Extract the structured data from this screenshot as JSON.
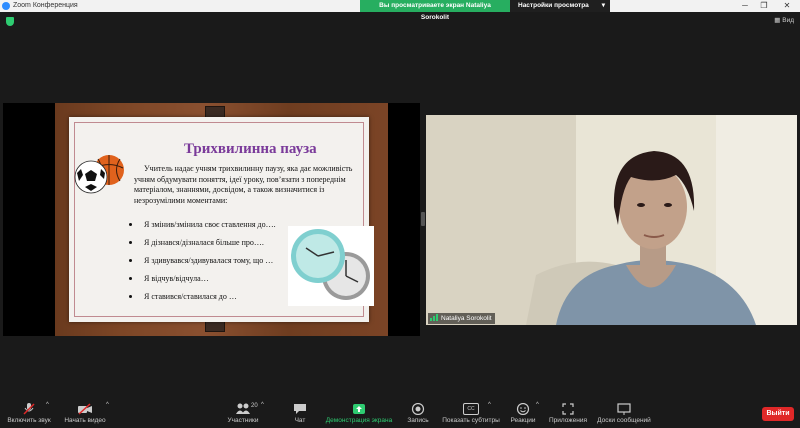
{
  "titlebar": {
    "app_title": "Zoom Конференция",
    "share_banner": "Вы просматриваете экран Nataliya Sorokolit",
    "view_options": "Настройки просмотра",
    "view_button": "Вид"
  },
  "slide": {
    "title": "Трихвилинна пауза",
    "intro": "Учитель надає учням трихвилинну паузу, яка дає можливість учням обдумувати поняття, ідеї уроку, пов’язати з попереднім матеріалом, знаннями, досвідом, а також визначитися із незрозумілими моментами:",
    "bullets": [
      "Я змінив/змінила своє ставлення до….",
      "Я дізнався/дізналася більше про….",
      "Я здивувався/здивувалася тому, що …",
      "Я відчув/відчула…",
      "Я ставився/ставилася до …"
    ]
  },
  "participant": {
    "name": "Nataliya Sorokolit"
  },
  "toolbar": {
    "audio_label": "Включить звук",
    "video_label": "Начать видео",
    "participants_label": "Участники",
    "participants_count": "20",
    "chat_label": "Чат",
    "share_label": "Демонстрация экрана",
    "record_label": "Запись",
    "captions_label": "Показать субтитры",
    "captions_icon_text": "CC",
    "reactions_label": "Реакции",
    "apps_label": "Приложения",
    "whiteboards_label": "Доски сообщений",
    "leave_label": "Выйти"
  },
  "icons": {
    "app": "zoom-icon",
    "shield": "shield-icon",
    "mic": "mic-muted-icon",
    "video": "video-off-icon",
    "participants": "participants-icon",
    "chat": "chat-icon",
    "share": "share-screen-icon",
    "record": "record-icon",
    "captions": "captions-icon",
    "reactions": "reactions-icon",
    "apps": "apps-icon",
    "whiteboards": "whiteboard-icon"
  },
  "colors": {
    "share_banner_bg": "#27ae60",
    "leave_button_bg": "#e02828",
    "slide_title": "#7a3a9a",
    "share_icon": "#2ecc71"
  }
}
